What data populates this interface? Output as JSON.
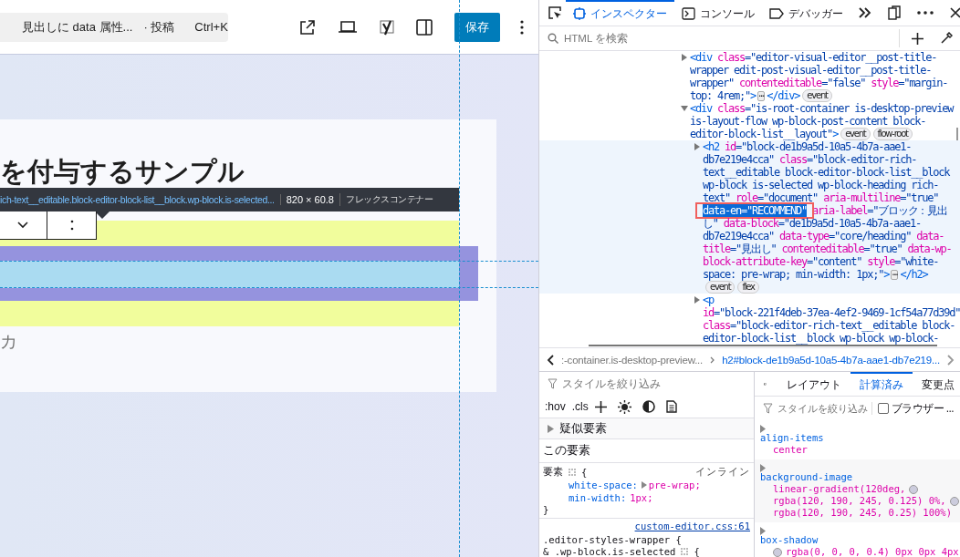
{
  "editor": {
    "command_bar": {
      "title": "見出しに data 属性...",
      "post_type": "· 投稿",
      "shortcut": "Ctrl+K"
    },
    "save_button": "保存",
    "heading": "を付与するサンプル",
    "paragraph_placeholder": "カ",
    "highlighter_tooltip": {
      "selector": "ich-text__editable.block-editor-block-list__block.wp-block.is-selected...",
      "size": "820 × 60.8",
      "layout": "フレックスコンテナー"
    }
  },
  "devtools": {
    "tabs": [
      {
        "label": "インスペクター",
        "selected": true,
        "kind": "inspector"
      },
      {
        "label": "コンソール",
        "selected": false,
        "kind": "console"
      },
      {
        "label": "デバッガー",
        "selected": false,
        "kind": "debugger"
      }
    ],
    "search": {
      "placeholder": "HTML を検索"
    },
    "markup": [
      {
        "expanded": false,
        "selected": false,
        "lines": [
          [
            {
              "kind": "code",
              "segments": [
                {
                  "kind": "tag",
                  "s": "<div"
                },
                {
                  "kind": "attr",
                  "s": " class"
                },
                {
                  "kind": "val",
                  "s": "=\"editor-visual-editor__post-title-"
                }
              ]
            }
          ],
          [
            {
              "kind": "code",
              "segments": [
                {
                  "kind": "val",
                  "s": "wrapper edit-post-visual-editor__post-title-"
                }
              ]
            }
          ],
          [
            {
              "kind": "code",
              "segments": [
                {
                  "kind": "val",
                  "s": "wrapper\""
                },
                {
                  "kind": "attr",
                  "s": " contenteditable"
                },
                {
                  "kind": "val",
                  "s": "=\"false\""
                },
                {
                  "kind": "attr",
                  "s": " style"
                },
                {
                  "kind": "val",
                  "s": "=\"margin-"
                }
              ]
            }
          ],
          [
            {
              "kind": "code",
              "segments": [
                {
                  "kind": "val",
                  "s": "top: 4rem;\""
                },
                {
                  "kind": "tag",
                  "s": ">"
                }
              ]
            },
            {
              "kind": "more",
              "label": "⋯"
            },
            {
              "kind": "code",
              "segments": [
                {
                  "kind": "tag",
                  "s": "</div>"
                }
              ]
            },
            {
              "kind": "badge",
              "label": "event"
            }
          ]
        ]
      },
      {
        "expanded": true,
        "selected": false,
        "lines": [
          [
            {
              "kind": "code",
              "segments": [
                {
                  "kind": "tag",
                  "s": "<div"
                },
                {
                  "kind": "attr",
                  "s": " class"
                },
                {
                  "kind": "val",
                  "s": "=\"is-root-container is-desktop-preview"
                }
              ]
            }
          ],
          [
            {
              "kind": "code",
              "segments": [
                {
                  "kind": "val",
                  "s": "is-layout-flow wp-block-post-content block-"
                }
              ]
            }
          ],
          [
            {
              "kind": "code",
              "segments": [
                {
                  "kind": "val",
                  "s": "editor-block-list__layout\""
                },
                {
                  "kind": "tag",
                  "s": ">"
                }
              ]
            },
            {
              "kind": "badge",
              "label": "event"
            },
            {
              "kind": "badge",
              "label": "flow-root"
            }
          ]
        ],
        "children": [
          {
            "expanded": false,
            "selected": true,
            "lines": [
              [
                {
                  "kind": "code",
                  "segments": [
                    {
                      "kind": "tag",
                      "s": "<h2"
                    },
                    {
                      "kind": "attr",
                      "s": " id"
                    },
                    {
                      "kind": "val",
                      "s": "=\"block-de1b9a5d-10a5-4b7a-aae1-"
                    }
                  ]
                }
              ],
              [
                {
                  "kind": "code",
                  "segments": [
                    {
                      "kind": "val",
                      "s": "db7e219e4cca\""
                    },
                    {
                      "kind": "attr",
                      "s": " class"
                    },
                    {
                      "kind": "val",
                      "s": "=\"block-editor-rich-"
                    }
                  ]
                }
              ],
              [
                {
                  "kind": "code",
                  "segments": [
                    {
                      "kind": "val",
                      "s": "text__editable block-editor-block-list__block"
                    }
                  ]
                }
              ],
              [
                {
                  "kind": "code",
                  "segments": [
                    {
                      "kind": "val",
                      "s": "wp-block is-selected wp-block-heading rich-"
                    }
                  ]
                }
              ],
              [
                {
                  "kind": "code",
                  "segments": [
                    {
                      "kind": "val",
                      "s": "text\""
                    },
                    {
                      "kind": "attr",
                      "s": " role"
                    },
                    {
                      "kind": "val",
                      "s": "=\"document\""
                    },
                    {
                      "kind": "attr",
                      "s": " aria-multiline"
                    },
                    {
                      "kind": "val",
                      "s": "=\"true\""
                    }
                  ]
                }
              ],
              [
                {
                  "kind": "highlight",
                  "label": "data-en=\"RECOMMEND\""
                },
                {
                  "kind": "code",
                  "segments": [
                    {
                      "kind": "attr",
                      "s": " aria-label"
                    },
                    {
                      "kind": "val",
                      "s": "=\"ブロック：見出"
                    }
                  ]
                }
              ],
              [
                {
                  "kind": "code",
                  "segments": [
                    {
                      "kind": "val",
                      "s": "し\""
                    },
                    {
                      "kind": "attr",
                      "s": " data-block"
                    },
                    {
                      "kind": "val",
                      "s": "=\"de1b9a5d-10a5-4b7a-aae1-"
                    }
                  ]
                }
              ],
              [
                {
                  "kind": "code",
                  "segments": [
                    {
                      "kind": "val",
                      "s": "db7e219e4cca\""
                    },
                    {
                      "kind": "attr",
                      "s": " data-type"
                    },
                    {
                      "kind": "val",
                      "s": "=\"core/heading\""
                    },
                    {
                      "kind": "attr",
                      "s": " data-"
                    }
                  ]
                }
              ],
              [
                {
                  "kind": "code",
                  "segments": [
                    {
                      "kind": "attr",
                      "s": "title"
                    },
                    {
                      "kind": "val",
                      "s": "=\"見出し\""
                    },
                    {
                      "kind": "attr",
                      "s": " contenteditable"
                    },
                    {
                      "kind": "val",
                      "s": "=\"true\""
                    },
                    {
                      "kind": "attr",
                      "s": " data-wp-"
                    }
                  ]
                }
              ],
              [
                {
                  "kind": "code",
                  "segments": [
                    {
                      "kind": "attr",
                      "s": "block-attribute-key"
                    },
                    {
                      "kind": "val",
                      "s": "=\"content\""
                    },
                    {
                      "kind": "attr",
                      "s": " style"
                    },
                    {
                      "kind": "val",
                      "s": "=\"white-"
                    }
                  ]
                }
              ],
              [
                {
                  "kind": "code",
                  "segments": [
                    {
                      "kind": "val",
                      "s": "space: pre-wrap; min-width: 1px;\""
                    },
                    {
                      "kind": "tag",
                      "s": ">"
                    }
                  ]
                },
                {
                  "kind": "more",
                  "label": "⋯"
                },
                {
                  "kind": "code",
                  "segments": [
                    {
                      "kind": "tag",
                      "s": "</h2>"
                    }
                  ]
                }
              ],
              [
                {
                  "kind": "badge",
                  "label": "event"
                },
                {
                  "kind": "badge",
                  "label": "flex"
                }
              ]
            ]
          },
          {
            "expanded": false,
            "selected": false,
            "lines": [
              [
                {
                  "kind": "code",
                  "segments": [
                    {
                      "kind": "tag",
                      "s": "<p"
                    }
                  ]
                }
              ],
              [
                {
                  "kind": "code",
                  "segments": [
                    {
                      "kind": "attr",
                      "s": "id"
                    },
                    {
                      "kind": "val",
                      "s": "=\"block-221f4deb-37ea-4ef2-9469-1cf54a77d39d\""
                    }
                  ]
                }
              ],
              [
                {
                  "kind": "code",
                  "segments": [
                    {
                      "kind": "attr",
                      "s": "class"
                    },
                    {
                      "kind": "val",
                      "s": "=\"block-editor-rich-text__editable block-"
                    }
                  ]
                }
              ],
              [
                {
                  "kind": "code",
                  "segments": [
                    {
                      "kind": "val",
                      "s": "editor-block-list__block wp-block wp-block-"
                    }
                  ]
                }
              ]
            ]
          }
        ]
      }
    ],
    "breadcrumbs": [
      {
        "label": ":-container.is-desktop-preview...",
        "selected": false
      },
      {
        "label": "h2#block-de1b9a5d-10a5-4b7a-aae1-db7e219...",
        "selected": true
      }
    ],
    "rules": {
      "filter_placeholder": "スタイルを絞り込み",
      "toolbar": [
        ":hov",
        ".cls"
      ],
      "pseudo_elements": "疑似要素",
      "this_element": "この要素",
      "inline_rule": {
        "selector": "要素",
        "brace_open": "{",
        "source": "インライン",
        "declarations": [
          {
            "name": "white-space:",
            "value": "pre-wrap;",
            "expandable": true
          },
          {
            "name": "min-width:",
            "value": "1px;",
            "expandable": false
          }
        ],
        "brace_close": "}"
      },
      "next_rule": {
        "source": "custom-editor.css:61",
        "lines": [
          ".editor-styles-wrapper {",
          "& .wp-block.is-selected"
        ],
        "brace_open": "{"
      }
    },
    "computed": {
      "tabs": [
        {
          "label": "レイアウト",
          "selected": false
        },
        {
          "label": "計算済み",
          "selected": true
        },
        {
          "label": "変更点",
          "selected": false
        }
      ],
      "filter_placeholder": "スタイルを絞り込み",
      "browser_styles": {
        "label": "ブラウザー ...",
        "checked": false
      },
      "properties": [
        {
          "name": "align-items",
          "values": [
            {
              "text": "center"
            }
          ]
        },
        {
          "name": "background-image",
          "values": [
            {
              "text": "linear-gradient(120deg,",
              "swatch_after": true
            },
            {
              "text": "rgba(120, 190, 245, 0.125) 0%,",
              "swatch_after": true
            },
            {
              "text": "rgba(120, 190, 245, 0.25) 100%)"
            }
          ]
        },
        {
          "name": "box-shadow",
          "values": [
            {
              "text": "rgba(0, 0, 0, 0.4) 0px 0px 4px",
              "swatch_before": true
            }
          ]
        }
      ]
    }
  }
}
